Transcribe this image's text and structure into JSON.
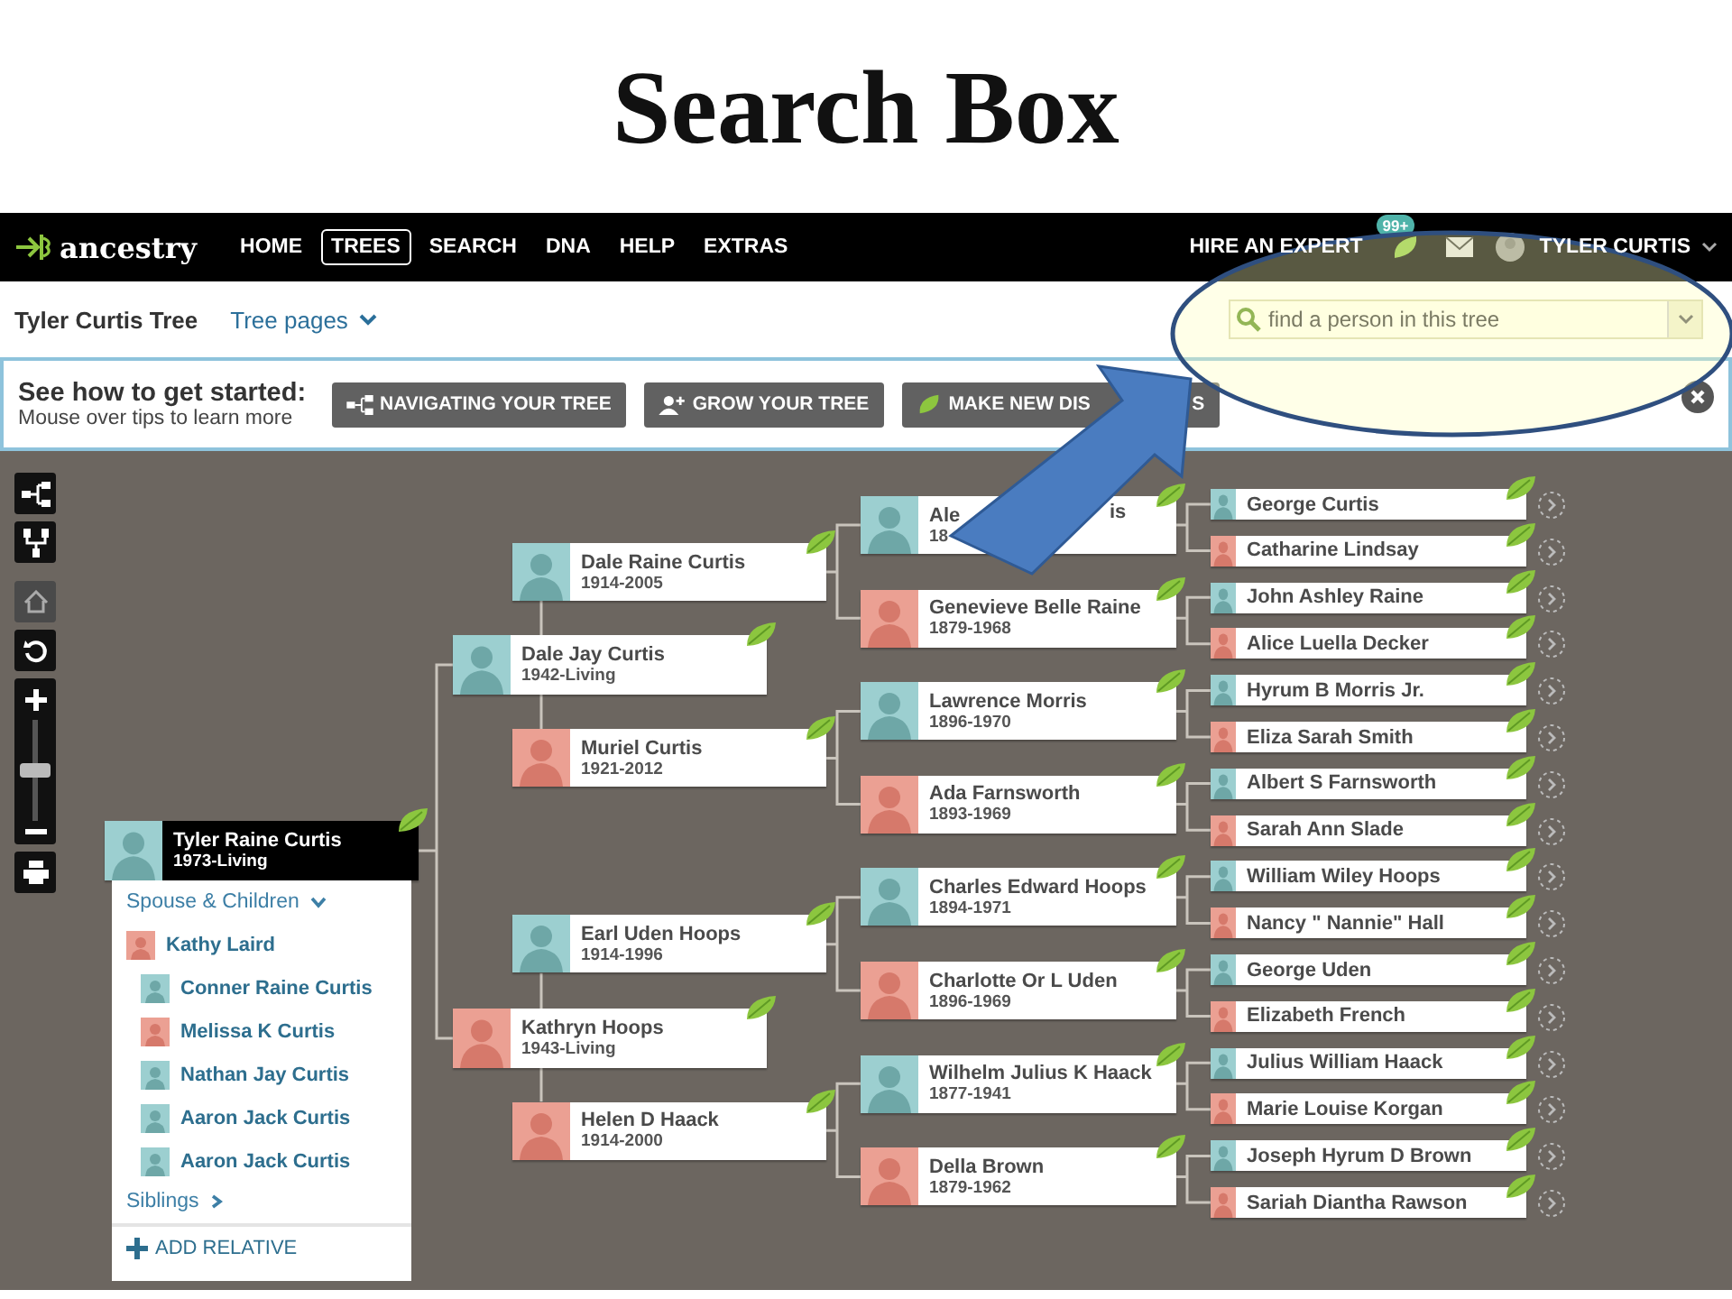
{
  "slide_title": "Search Box",
  "nav": {
    "logo": "ancestry",
    "items": [
      {
        "label": "HOME",
        "selected": false
      },
      {
        "label": "TREES",
        "selected": true
      },
      {
        "label": "SEARCH",
        "selected": false
      },
      {
        "label": "DNA",
        "selected": false
      },
      {
        "label": "HELP",
        "selected": false
      },
      {
        "label": "EXTRAS",
        "selected": false
      }
    ],
    "hire": "HIRE AN EXPERT",
    "hint_count": "99+",
    "user": "TYLER CURTIS"
  },
  "subheader": {
    "tree_name": "Tyler Curtis Tree",
    "tree_pages": "Tree pages",
    "search": {
      "placeholder": "find a person in this tree"
    }
  },
  "banner": {
    "title": "See how to get started:",
    "subtitle": "Mouse over tips to learn more",
    "buttons": [
      {
        "label": "NAVIGATING YOUR TREE"
      },
      {
        "label": "GROW YOUR TREE"
      },
      {
        "label": "MAKE NEW DIS",
        "label_tail": "S"
      }
    ]
  },
  "toolbar": [
    {
      "kind": "pedigree",
      "disabled": false
    },
    {
      "kind": "family",
      "disabled": false
    },
    {
      "kind": "home",
      "disabled": true
    },
    {
      "kind": "reset",
      "disabled": false
    },
    {
      "kind": "zoom",
      "level": 0.5
    },
    {
      "kind": "print",
      "disabled": false
    }
  ],
  "tree": {
    "name": "Tyler Raine Curtis",
    "dates": "1973-Living",
    "kind": "male",
    "hint": true,
    "parents": [
      {
        "name": "Dale Jay Curtis",
        "dates": "1942-Living",
        "kind": "male",
        "hint": true,
        "parents": [
          {
            "name": "Dale Raine Curtis",
            "dates": "1914-2005",
            "kind": "male",
            "hint": true,
            "parents": [
              {
                "name": "Ale",
                "name_tail": "is",
                "dates": "18",
                "kind": "male",
                "hint": true,
                "parents": [
                  {
                    "name": "George Curtis",
                    "kind": "male",
                    "hint": true,
                    "more": true
                  },
                  {
                    "name": "Catharine Lindsay",
                    "kind": "female",
                    "hint": true,
                    "more": true
                  }
                ]
              },
              {
                "name": "Genevieve Belle Raine",
                "dates": "1879-1968",
                "kind": "female",
                "hint": true,
                "parents": [
                  {
                    "name": "John Ashley Raine",
                    "kind": "male",
                    "hint": true,
                    "more": true
                  },
                  {
                    "name": "Alice Luella Decker",
                    "kind": "female",
                    "hint": true,
                    "more": true
                  }
                ]
              }
            ]
          },
          {
            "name": "Muriel Curtis",
            "dates": "1921-2012",
            "kind": "female",
            "hint": true,
            "parents": [
              {
                "name": "Lawrence Morris",
                "dates": "1896-1970",
                "kind": "male",
                "hint": true,
                "parents": [
                  {
                    "name": "Hyrum B Morris Jr.",
                    "kind": "male",
                    "hint": true,
                    "more": true
                  },
                  {
                    "name": "Eliza Sarah Smith",
                    "kind": "female",
                    "hint": true,
                    "more": true
                  }
                ]
              },
              {
                "name": "Ada Farnsworth",
                "dates": "1893-1969",
                "kind": "female",
                "hint": true,
                "parents": [
                  {
                    "name": "Albert S Farnsworth",
                    "kind": "male",
                    "hint": true,
                    "more": true
                  },
                  {
                    "name": "Sarah Ann Slade",
                    "kind": "female",
                    "hint": true,
                    "more": true
                  }
                ]
              }
            ]
          }
        ]
      },
      {
        "name": "Kathryn Hoops",
        "dates": "1943-Living",
        "kind": "female",
        "hint": true,
        "parents": [
          {
            "name": "Earl Uden Hoops",
            "dates": "1914-1996",
            "kind": "male",
            "hint": true,
            "parents": [
              {
                "name": "Charles Edward Hoops",
                "dates": "1894-1971",
                "kind": "male",
                "hint": true,
                "parents": [
                  {
                    "name": "William Wiley Hoops",
                    "kind": "male",
                    "hint": true,
                    "more": true
                  },
                  {
                    "name": "Nancy \" Nannie\" Hall",
                    "kind": "female",
                    "hint": true,
                    "more": true
                  }
                ]
              },
              {
                "name": "Charlotte Or L Uden",
                "dates": "1896-1969",
                "kind": "female",
                "hint": true,
                "parents": [
                  {
                    "name": "George Uden",
                    "kind": "male",
                    "hint": true,
                    "more": true
                  },
                  {
                    "name": "Elizabeth French",
                    "kind": "female",
                    "hint": true,
                    "more": true
                  }
                ]
              }
            ]
          },
          {
            "name": "Helen D Haack",
            "dates": "1914-2000",
            "kind": "female",
            "hint": true,
            "parents": [
              {
                "name": "Wilhelm Julius K Haack",
                "dates": "1877-1941",
                "kind": "male",
                "hint": true,
                "parents": [
                  {
                    "name": "Julius William Haack",
                    "kind": "male",
                    "hint": true,
                    "more": true
                  },
                  {
                    "name": "Marie Louise Korgan",
                    "kind": "female",
                    "hint": true,
                    "more": true
                  }
                ]
              },
              {
                "name": "Della Brown",
                "dates": "1879-1962",
                "kind": "female",
                "hint": true,
                "parents": [
                  {
                    "name": "Joseph Hyrum D Brown",
                    "kind": "male",
                    "hint": true,
                    "more": true
                  },
                  {
                    "name": "Sariah Diantha Rawson",
                    "kind": "female",
                    "hint": true,
                    "more": true
                  }
                ]
              }
            ]
          }
        ]
      }
    ]
  },
  "family_panel": {
    "heading": {
      "label": "Spouse & Children",
      "expanded": true
    },
    "spouse": {
      "name": "Kathy Laird",
      "kind": "female",
      "children": [
        {
          "name": "Conner Raine Curtis",
          "kind": "male"
        },
        {
          "name": "Melissa K Curtis",
          "kind": "female"
        },
        {
          "name": "Nathan Jay Curtis",
          "kind": "male"
        },
        {
          "name": "Aaron Jack Curtis",
          "kind": "male"
        },
        {
          "name": "Aaron Jack Curtis",
          "kind": "male"
        }
      ]
    },
    "siblings": {
      "label": "Siblings",
      "expanded": false
    },
    "add_relative": "ADD RELATIVE"
  }
}
